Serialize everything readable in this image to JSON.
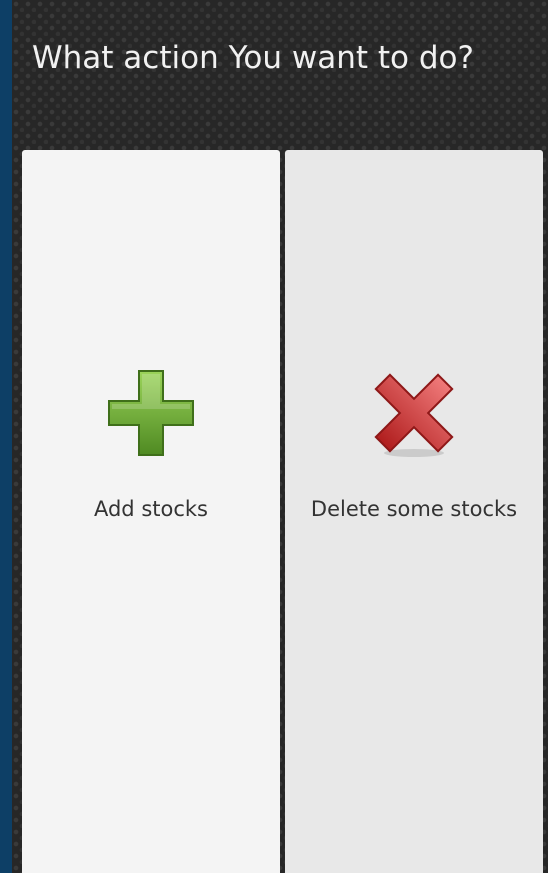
{
  "dialog": {
    "title": "What action You want to do?"
  },
  "actions": [
    {
      "label": "Add stocks",
      "icon": "plus-icon",
      "color": "#6aa63a"
    },
    {
      "label": "Delete some stocks",
      "icon": "cross-icon",
      "color": "#d23a3a"
    }
  ]
}
